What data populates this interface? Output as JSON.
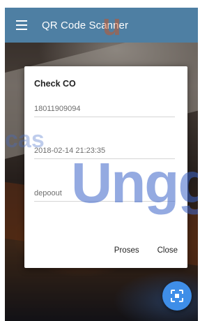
{
  "app": {
    "title": "QR Code Scanner",
    "menu_icon": "hamburger-icon",
    "accent": "#4e7fa3"
  },
  "dialog": {
    "title": "Check CO",
    "fields": [
      {
        "value": "18011909094"
      },
      {
        "value": "2018-02-14 21:23:35"
      },
      {
        "value": "depoout"
      }
    ],
    "buttons": {
      "proses": "Proses",
      "close": "Close"
    }
  },
  "fab": {
    "icon": "scan-icon",
    "color": "#3f8ee8"
  },
  "watermark": {
    "top_fragment": "u",
    "mid_fragment": "cas",
    "main": "Ungg"
  }
}
